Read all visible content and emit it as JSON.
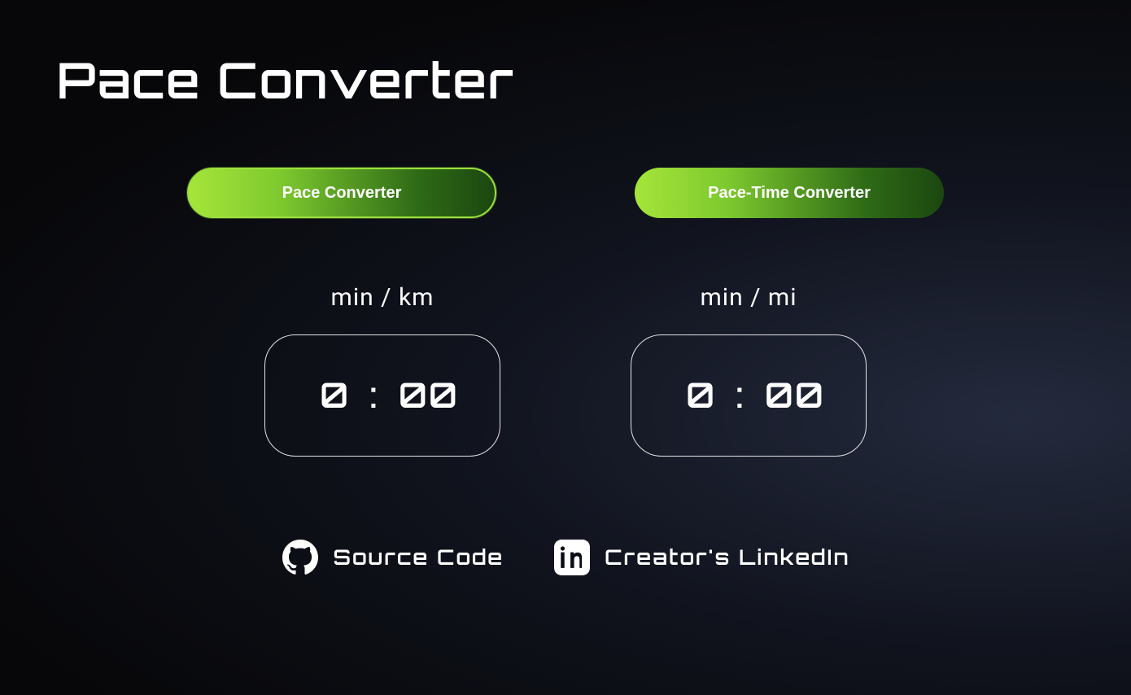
{
  "header": {
    "title": "Pace Converter"
  },
  "tabs": {
    "pace_converter": "Pace Converter",
    "pace_time_converter": "Pace-Time Converter",
    "active": "pace_converter"
  },
  "inputs": {
    "km": {
      "label": "min / km",
      "minutes": "0",
      "seconds": "00",
      "min_placeholder": "0",
      "sec_placeholder": "00"
    },
    "mi": {
      "label": "min / mi",
      "minutes": "0",
      "seconds": "00",
      "min_placeholder": "0",
      "sec_placeholder": "00"
    },
    "separator": ":"
  },
  "footer": {
    "source_code": "Source Code",
    "linkedin": "Creator's LinkedIn"
  }
}
